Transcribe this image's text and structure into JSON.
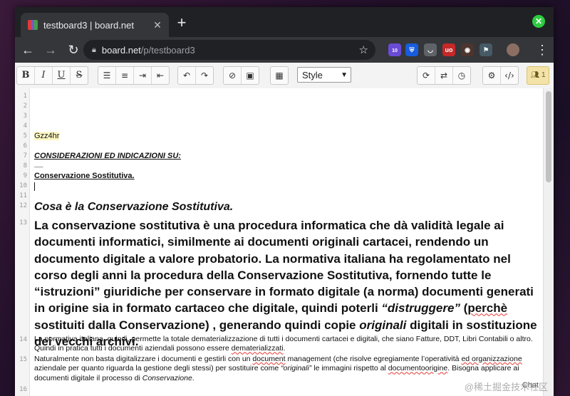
{
  "browser": {
    "tab_title": "testboard3 | board.net",
    "tab_close": "✕",
    "new_tab": "+",
    "url_domain": "board.net",
    "url_path": "/p/testboard3"
  },
  "extensions": [
    {
      "name": "purple-extension-icon",
      "badge": "10",
      "color": "#6a4bd6"
    },
    {
      "name": "bitwarden-icon",
      "badge": "",
      "color": "#175ddc"
    },
    {
      "name": "pocket-icon",
      "badge": "",
      "color": "#5f6368"
    },
    {
      "name": "ublock-icon",
      "badge": "",
      "color": "#c62828"
    },
    {
      "name": "privacy-icon",
      "badge": "",
      "color": "#4e342e"
    },
    {
      "name": "extension-icon",
      "badge": "",
      "color": "#455a64"
    },
    {
      "name": "avatar",
      "badge": "",
      "color": "#8d6e63"
    }
  ],
  "toolbar": {
    "style_select": "Style",
    "users_count": "1"
  },
  "editor": {
    "line_numbers": [
      "1",
      "2",
      "3",
      "4",
      "5",
      "6",
      "7",
      "8",
      "9",
      "10",
      "11",
      "12",
      "13",
      "14",
      "15",
      "16"
    ],
    "l5": "Gzz4hr",
    "l7": "CONSIDERAZIONI ED INDICAZIONI SU:",
    "l8": "__",
    "l9": "Conservazione Sostitutiva.",
    "l12": "Cosa è la Conservazione Sostitutiva.",
    "l13_a": "La conservazione sostitutiva è una procedura informatica che dà validità legale ai documenti informatici, similmente ai documenti originali cartacei, rendendo un documento digitale a valore probatorio. La normativa italiana ha regolamentato nel corso degli anni la procedura della Conservazione Sostitutiva, fornendo tutte le “istruzioni” giuridiche  per conservare in formato digitale  (a norma) documenti generati in origine sia in formato cartaceo che digitale, quindi poterli  ",
    "l13_b": "“distruggere”",
    "l13_c": " (",
    "l13_d": "perchè",
    "l13_e": " sostituiti dalla Conservazione) , generando quindi copie ",
    "l13_f": "originali",
    "l13_g": " digitali in sostituzione dei vecchi archivi.",
    "l14_a": "La normativa italiana, quindi, permette la totale dematerializzazione di tutti i documenti cartacei e digitali, che siano Fatture, DDT,  Libri Contabili o altro. Quindi in pratica tutti i documenti aziendali possono essere ",
    "l14_b": "dematerializzati",
    "l14_c": ".",
    "l15_a": "Naturalmente non basta digitalizzare i documenti e gestirli con un  ",
    "l15_b": "document",
    "l15_c": " management (che risolve egregiamente l’operatività ",
    "l15_d": "ed organizzazione",
    "l15_e": " aziendale per quanto riguarda la gestione degli stessi)  per sostituire come ",
    "l15_f": "“originali”",
    "l15_g": " le immagini rispetto al ",
    "l15_h": "documentoorigine",
    "l15_i": ". Bisogna applicare ai documenti digitale il processo di ",
    "l15_j": "Conservazione",
    "l15_k": ".",
    "chat_label": "Chat",
    "watermark": "@稀土掘金技术社区"
  }
}
